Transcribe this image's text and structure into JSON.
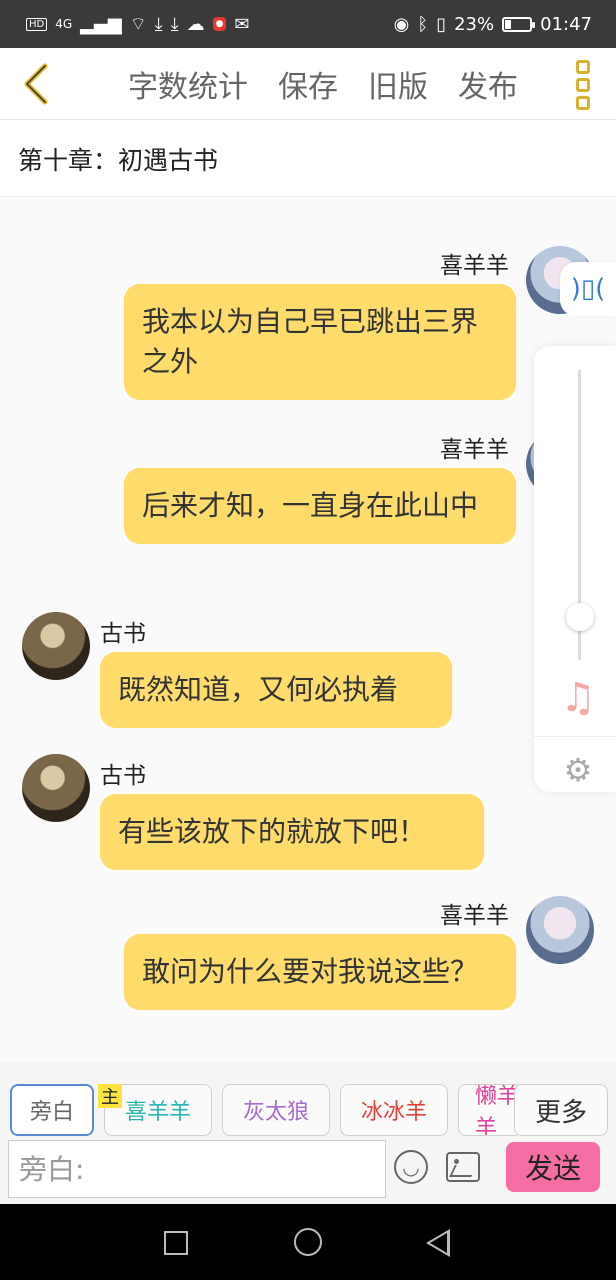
{
  "status": {
    "hd": "HD",
    "network": "4G",
    "battery": "23%",
    "battery_level": 0.23,
    "time": "01:47"
  },
  "toolbar": {
    "word_count_label": "字数统计",
    "save_label": "保存",
    "old_version_label": "旧版",
    "publish_label": "发布"
  },
  "chapter": {
    "title": "第十章：初遇古书"
  },
  "messages": [
    {
      "speaker": "喜羊羊",
      "text": "我本以为自己早已跳出三界之外"
    },
    {
      "speaker": "喜羊羊",
      "text": "后来才知，一直身在此山中"
    },
    {
      "speaker": "古书",
      "text": "既然知道，又何必执着"
    },
    {
      "speaker": "古书",
      "text": "有些该放下的就放下吧！"
    },
    {
      "speaker": "喜羊羊",
      "text": "敢问为什么要对我说这些？"
    }
  ],
  "side_panel": {
    "volume_level": 0.1
  },
  "roles": {
    "items": [
      "旁白",
      "喜羊羊",
      "灰太狼",
      "冰冰羊",
      "懒羊羊"
    ],
    "more_label": "更多",
    "host_badge": "主",
    "colors": {
      "narrator": "#555555",
      "xiyangyang": "#2bb5b0",
      "huitailang": "#a56cd6",
      "bingbingyang": "#e0433a",
      "lanyangyang": "#e0439a"
    }
  },
  "input": {
    "placeholder": "旁白:",
    "send_label": "发送"
  }
}
